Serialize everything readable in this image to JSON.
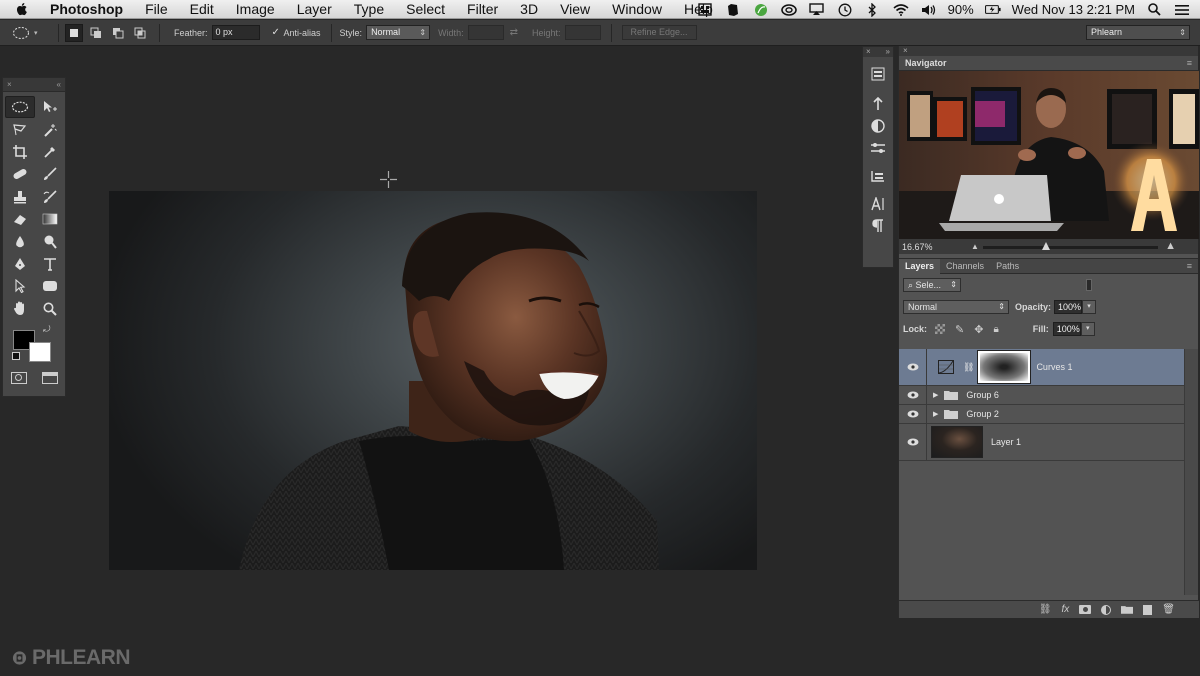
{
  "menubar": {
    "app_name": "Photoshop",
    "items": [
      "File",
      "Edit",
      "Image",
      "Layer",
      "Type",
      "Select",
      "Filter",
      "3D",
      "View",
      "Window",
      "Help"
    ],
    "battery": "90%",
    "datetime": "Wed Nov 13  2:21 PM"
  },
  "options": {
    "feather_label": "Feather:",
    "feather_value": "0 px",
    "antialias_label": "Anti-alias",
    "style_label": "Style:",
    "style_value": "Normal",
    "width_label": "Width:",
    "height_label": "Height:",
    "refine_edge": "Refine Edge...",
    "workspace": "Phlearn"
  },
  "navigator": {
    "title": "Navigator",
    "zoom": "16.67%"
  },
  "layers_panel": {
    "tabs": [
      "Layers",
      "Channels",
      "Paths"
    ],
    "filter_placeholder": "Sele...",
    "blend_mode": "Normal",
    "opacity_label": "Opacity:",
    "opacity_value": "100%",
    "lock_label": "Lock:",
    "fill_label": "Fill:",
    "fill_value": "100%",
    "layers": [
      {
        "name": "Curves 1",
        "type": "adjustment",
        "selected": true
      },
      {
        "name": "Group 6",
        "type": "group"
      },
      {
        "name": "Group 2",
        "type": "group"
      },
      {
        "name": "Layer 1",
        "type": "pixel"
      }
    ]
  },
  "watermark": "PHLEARN",
  "colors": {
    "selection": "#6d7b92",
    "panel": "#535353",
    "workspace": "#282828"
  }
}
